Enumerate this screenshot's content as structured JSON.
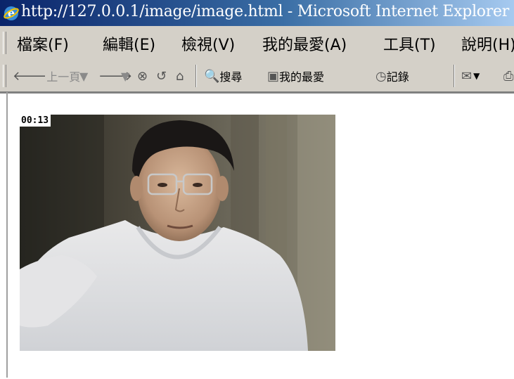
{
  "window": {
    "title": "http://127.0.0.1/image/image.html - Microsoft Internet Explorer"
  },
  "menu": {
    "items": [
      "檔案(F)",
      "編輯(E)",
      "檢視(V)",
      "我的最愛(A)",
      "工具(T)",
      "說明(H)"
    ]
  },
  "toolbar": {
    "back_label": "上一頁",
    "search_label": "搜尋",
    "favorites_label": "我的最愛",
    "history_label": "記錄"
  },
  "webcam": {
    "timestamp": "00:13"
  }
}
